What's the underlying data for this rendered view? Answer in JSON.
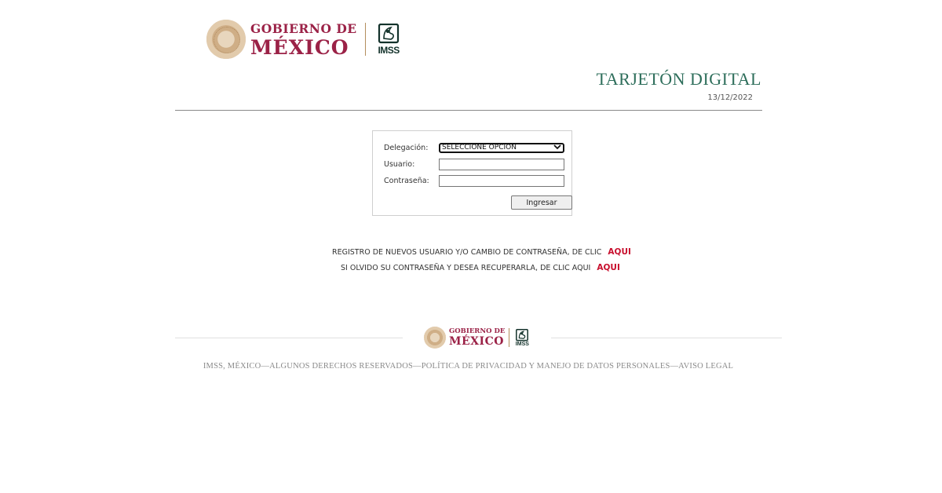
{
  "header": {
    "gobierno_line1": "GOBIERNO DE",
    "gobierno_line2": "MÉXICO",
    "imss_label": "IMSS",
    "title": "TARJETÓN DIGITAL",
    "date": "13/12/2022"
  },
  "login": {
    "delegacion_label": "Delegación:",
    "delegacion_value": "SELECCIONE OPCION",
    "usuario_label": "Usuario:",
    "usuario_value": "",
    "password_label": "Contraseña:",
    "password_value": "",
    "submit_label": "Ingresar"
  },
  "links": {
    "register_text": "REGISTRO DE NUEVOS USUARIO Y/O CAMBIO DE CONTRASEÑA, DE CLIC",
    "register_link": "AQUI",
    "recover_text": "SI OLVIDO SU CONTRASEÑA Y DESEA RECUPERARLA, DE CLIC AQUI",
    "recover_link": "AQUI"
  },
  "footer": {
    "gobierno_line1": "GOBIERNO DE",
    "gobierno_line2": "MÉXICO",
    "imss_label": "IMSS",
    "legal_text": "IMSS, MÉXICO—ALGUNOS DERECHOS RESERVADOS—POLÍTICA DE PRIVACIDAD Y MANEJO DE DATOS PERSONALES—AVISO LEGAL"
  },
  "colors": {
    "brand_guinda": "#9b2247",
    "title_green": "#2e6e5b",
    "link_red": "#c8102e",
    "gold": "#b38e5d"
  }
}
